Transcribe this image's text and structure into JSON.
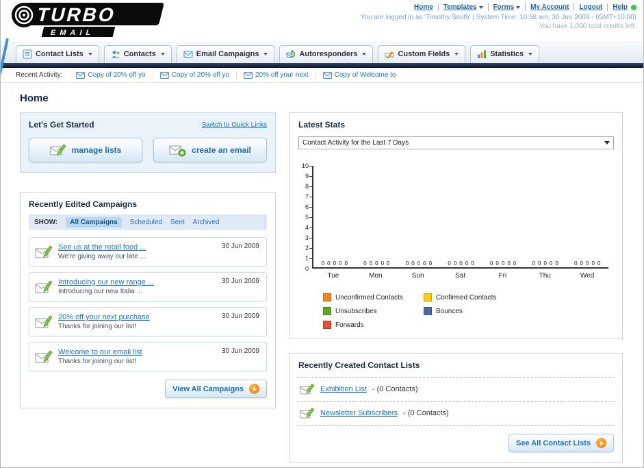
{
  "header": {
    "logo_primary": "TURBO",
    "logo_secondary": "EMAIL",
    "nav": [
      {
        "label": "Home"
      },
      {
        "label": "Templates",
        "dropdown": true
      },
      {
        "label": "Forms",
        "dropdown": true
      },
      {
        "label": "My Account"
      },
      {
        "label": "Logout"
      },
      {
        "label": "Help"
      }
    ],
    "login_line": "You are logged in as 'Timothy Smith' | System Time: 10:58 am, 30 Jun 2009 - (GMT+10:00)",
    "credits_line": "You have 1,000 total credits left."
  },
  "nav_tabs": [
    {
      "label": "Contact Lists"
    },
    {
      "label": "Contacts"
    },
    {
      "label": "Email Campaigns"
    },
    {
      "label": "Autoresponders"
    },
    {
      "label": "Custom Fields"
    },
    {
      "label": "Statistics"
    }
  ],
  "recent_activity": {
    "label": "Recent Activity:",
    "items": [
      "Copy of 20% off yo",
      "Copy of 20% off yo",
      "20% off your next",
      "Copy of Welcome to"
    ]
  },
  "page_title": "Home",
  "get_started": {
    "title": "Let's Get Started",
    "switch_link": "Switch to Quick Links",
    "buttons": [
      {
        "label": "manage lists"
      },
      {
        "label": "create an email"
      }
    ]
  },
  "campaigns": {
    "title": "Recently Edited Campaigns",
    "show_label": "SHOW:",
    "filters": [
      "All Campaigns",
      "Scheduled",
      "Sent",
      "Archived"
    ],
    "active_filter": "All Campaigns",
    "items": [
      {
        "title": "See us at the retail food ...",
        "subtitle": "We're giving away our late ...",
        "date": "30 Jun 2009"
      },
      {
        "title": "Introducing our new range ...",
        "subtitle": "Introducing our new Italia ...",
        "date": "30 Jun 2009"
      },
      {
        "title": "20% off your next purchase",
        "subtitle": "Thanks for joining our list!",
        "date": "30 Jun 2009"
      },
      {
        "title": "Welcome to our email list",
        "subtitle": "Thanks for joining our list!",
        "date": "30 Jun 2009"
      }
    ],
    "view_all_label": "View All Campaigns"
  },
  "latest_stats": {
    "title": "Latest Stats",
    "dropdown_value": "Contact Activity for the Last 7 Days",
    "chart": {
      "type": "bar",
      "categories": [
        "Tue",
        "Mon",
        "Sun",
        "Sat",
        "Fri",
        "Thu",
        "Wed"
      ],
      "series": [
        {
          "name": "Unconfirmed Contacts",
          "color": "#f5821f",
          "values": [
            0,
            0,
            0,
            0,
            0,
            0,
            0
          ]
        },
        {
          "name": "Confirmed Contacts",
          "color": "#ffcc00",
          "values": [
            0,
            0,
            0,
            0,
            0,
            0,
            0
          ]
        },
        {
          "name": "Unsubscribes",
          "color": "#63a620",
          "values": [
            0,
            0,
            0,
            0,
            0,
            0,
            0
          ]
        },
        {
          "name": "Bounces",
          "color": "#4a69a5",
          "values": [
            0,
            0,
            0,
            0,
            0,
            0,
            0
          ]
        },
        {
          "name": "Forwards",
          "color": "#e8502d",
          "values": [
            0,
            0,
            0,
            0,
            0,
            0,
            0
          ]
        }
      ],
      "ylim": [
        0,
        10
      ],
      "yticks": [
        0,
        1,
        2,
        3,
        4,
        5,
        6,
        7,
        8,
        9,
        10
      ],
      "legend_position": "bottom",
      "grid": false
    }
  },
  "contact_lists": {
    "title": "Recently Created Contact Lists",
    "items": [
      {
        "name": "Exhibition List",
        "suffix": "- (0 Contacts)"
      },
      {
        "name": "Newsletter Subscribers",
        "suffix": "- (0 Contacts)"
      }
    ],
    "see_all_label": "See All Contact Lists"
  }
}
